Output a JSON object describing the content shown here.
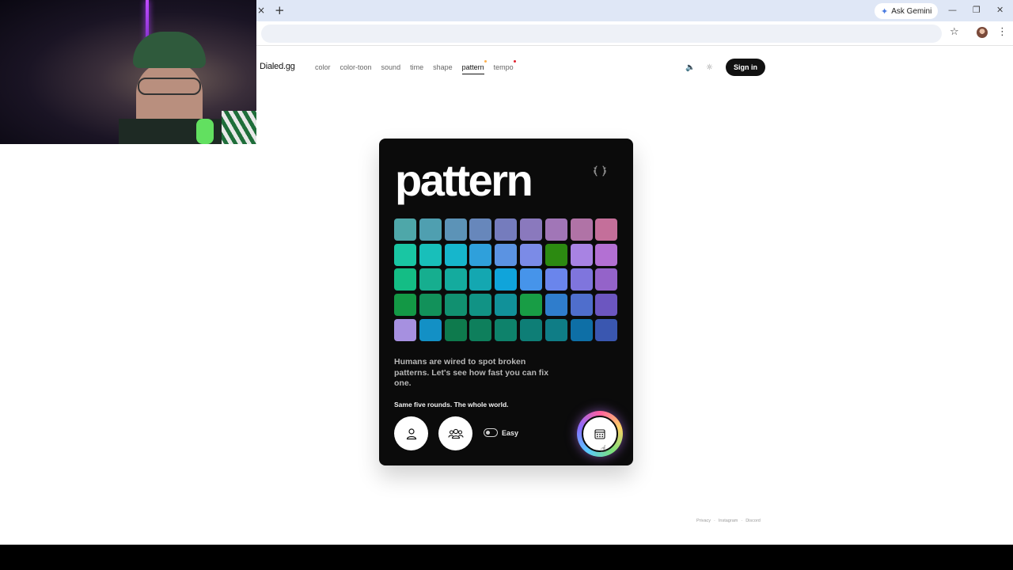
{
  "browser": {
    "tab_close": "×",
    "new_tab": "+",
    "gemini_label": "Ask Gemini",
    "minimize": "—",
    "restore": "❐",
    "close": "✕",
    "bookmark_icon": "star-icon",
    "menu": "⋮"
  },
  "site": {
    "brand": "Dialed.gg",
    "nav": [
      {
        "label": "color",
        "active": false
      },
      {
        "label": "color-toon",
        "active": false
      },
      {
        "label": "sound",
        "active": false
      },
      {
        "label": "time",
        "active": false
      },
      {
        "label": "shape",
        "active": false
      },
      {
        "label": "pattern",
        "active": true,
        "dot": "#ffb14d"
      },
      {
        "label": "tempo",
        "active": false,
        "dot": "#e0202e"
      }
    ],
    "sound_icon": "🔈",
    "theme_icon": "☼",
    "signin": "Sign in"
  },
  "card": {
    "title": "pattern",
    "description": "Humans are wired to spot broken patterns. Let's see how fast you can fix one.",
    "subtitle": "Same five rounds. The whole world.",
    "toggle_label": "Easy",
    "toggle_on": false,
    "tiles": [
      [
        "#4ea7a9",
        "#4f9fb0",
        "#5c93b7",
        "#6787bb",
        "#757cbd",
        "#8a79bd",
        "#a176b7",
        "#b073a6",
        "#c46f9a"
      ],
      [
        "#19c6a3",
        "#18bfba",
        "#16b6cc",
        "#2fa0db",
        "#5b93e2",
        "#7b8be7",
        "#2c8a11",
        "#a883e3",
        "#b370d3"
      ],
      [
        "#14bd85",
        "#16ae8f",
        "#14ab9e",
        "#14a7b1",
        "#10a4da",
        "#4694ea",
        "#6a85ec",
        "#7f75dd",
        "#9463c9"
      ],
      [
        "#139845",
        "#12915a",
        "#119070",
        "#119385",
        "#119199",
        "#189d45",
        "#2f7dcc",
        "#4f6ecc",
        "#6c56c0"
      ],
      [
        "#a690e0",
        "#1390c5",
        "#0e7a4d",
        "#0e7f5c",
        "#0e826b",
        "#0e7e76",
        "#0f7d86",
        "#0e6fa6",
        "#3a57b0"
      ]
    ],
    "tile_size_px": 28,
    "footer": [
      "Privacy",
      "Instagram",
      "Discord"
    ]
  }
}
